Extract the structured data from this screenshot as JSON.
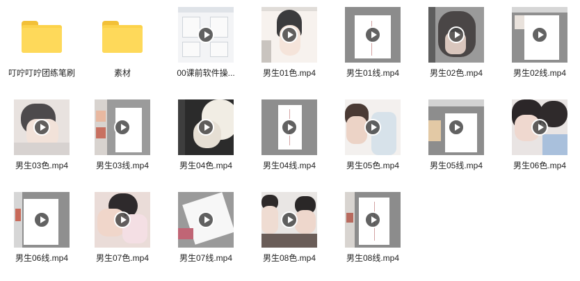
{
  "items": [
    {
      "label": "叮咛叮咛团练笔刷",
      "type": "folder",
      "icon": "folder-icon"
    },
    {
      "label": "素材",
      "type": "folder",
      "icon": "folder-icon"
    },
    {
      "label": "00课前软件操...",
      "type": "video",
      "icon": "video-thumbnail"
    },
    {
      "label": "男生01色.mp4",
      "type": "video",
      "icon": "video-thumbnail"
    },
    {
      "label": "男生01线.mp4",
      "type": "video",
      "icon": "video-thumbnail"
    },
    {
      "label": "男生02色.mp4",
      "type": "video",
      "icon": "video-thumbnail"
    },
    {
      "label": "男生02线.mp4",
      "type": "video",
      "icon": "video-thumbnail"
    },
    {
      "label": "男生03色.mp4",
      "type": "video",
      "icon": "video-thumbnail"
    },
    {
      "label": "男生03线.mp4",
      "type": "video",
      "icon": "video-thumbnail"
    },
    {
      "label": "男生04色.mp4",
      "type": "video",
      "icon": "video-thumbnail"
    },
    {
      "label": "男生04线.mp4",
      "type": "video",
      "icon": "video-thumbnail"
    },
    {
      "label": "男生05色.mp4",
      "type": "video",
      "icon": "video-thumbnail"
    },
    {
      "label": "男生05线.mp4",
      "type": "video",
      "icon": "video-thumbnail"
    },
    {
      "label": "男生06色.mp4",
      "type": "video",
      "icon": "video-thumbnail"
    },
    {
      "label": "男生06线.mp4",
      "type": "video",
      "icon": "video-thumbnail"
    },
    {
      "label": "男生07色.mp4",
      "type": "video",
      "icon": "video-thumbnail"
    },
    {
      "label": "男生07线.mp4",
      "type": "video",
      "icon": "video-thumbnail"
    },
    {
      "label": "男生08色.mp4",
      "type": "video",
      "icon": "video-thumbnail"
    },
    {
      "label": "男生08线.mp4",
      "type": "video",
      "icon": "video-thumbnail"
    }
  ],
  "colors": {
    "folder": "#fcd24a",
    "play_button": "#464646",
    "label_text": "#222222"
  }
}
